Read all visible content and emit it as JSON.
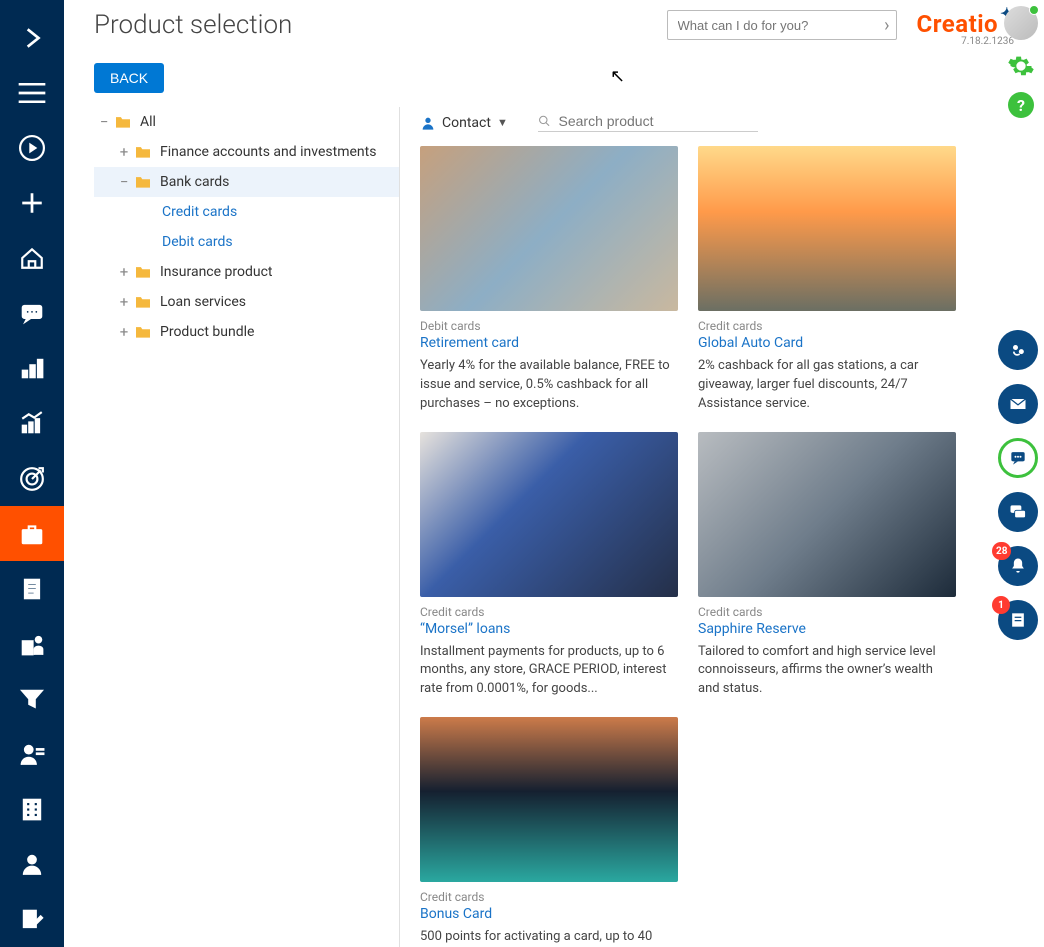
{
  "header": {
    "title": "Product selection",
    "search_placeholder": "What can I do for you?",
    "logo": "Creatio",
    "version": "7.18.2.1236"
  },
  "back_label": "BACK",
  "tree": {
    "all": "All",
    "items": [
      {
        "label": "Finance accounts and investments",
        "expand": "+"
      },
      {
        "label": "Bank cards",
        "expand": "−",
        "selected": true
      },
      {
        "label": "Credit cards"
      },
      {
        "label": "Debit cards"
      },
      {
        "label": "Insurance product",
        "expand": "+"
      },
      {
        "label": "Loan services",
        "expand": "+"
      },
      {
        "label": "Product bundle",
        "expand": "+"
      }
    ]
  },
  "filterbar": {
    "contact_label": "Contact",
    "search_placeholder": "Search product"
  },
  "cards": [
    {
      "category": "Debit cards",
      "title": "Retirement card",
      "desc": "Yearly 4% for the available balance, FREE to issue and service, 0.5% cashback for all purchases – no exceptions."
    },
    {
      "category": "Credit cards",
      "title": "Global Auto Card",
      "desc": "2% cashback for all gas stations, a car giveaway, larger fuel discounts, 24/7 Assistance service."
    },
    {
      "category": "Credit cards",
      "title": "“Morsel” loans",
      "desc": "Installment payments for products, up to 6 months, any store, GRACE PERIOD, interest rate from 0.0001%, for goods..."
    },
    {
      "category": "Credit cards",
      "title": "Sapphire Reserve",
      "desc": "Tailored to comfort and high service level connoisseurs, affirms the owner’s wealth and status."
    },
    {
      "category": "Credit cards",
      "title": "Bonus Card",
      "desc": "500 points for activating a card, up to 40"
    }
  ],
  "badges": {
    "bell": "28",
    "feed": "1"
  },
  "leftnav": {
    "expand": "expand-icon",
    "menu": "menu-icon",
    "play": "play-icon",
    "add": "plus-icon",
    "home": "home-icon",
    "chat": "chat-icon",
    "bars": "chart-icon",
    "growth": "growth-icon",
    "target": "target-icon",
    "briefcase": "briefcase-icon",
    "doc": "document-icon",
    "building": "building-icon",
    "funnel": "funnel-icon",
    "contact": "contact-icon",
    "company": "company-icon",
    "person": "person-icon",
    "edit": "edit-icon"
  },
  "help_label": "?"
}
